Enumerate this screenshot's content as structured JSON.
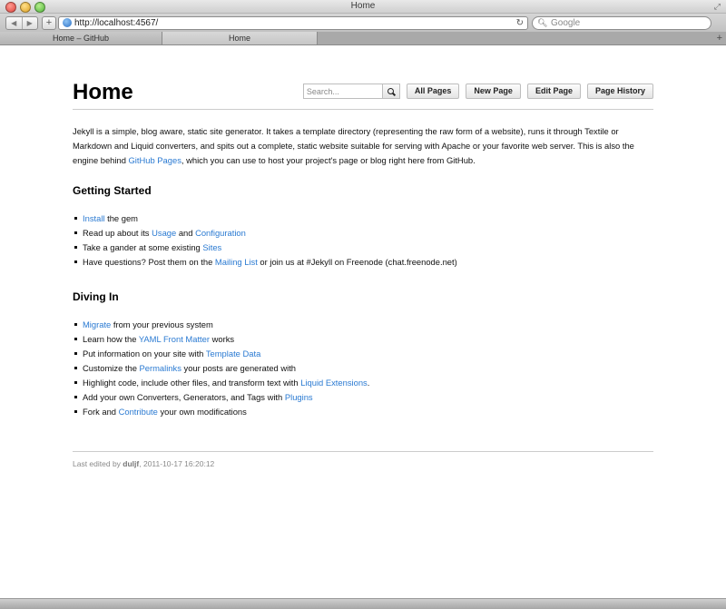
{
  "browser": {
    "window_title": "Home",
    "url": "http://localhost:4567/",
    "search_placeholder": "Google",
    "tabs": [
      "Home – GitHub",
      "Home"
    ],
    "back_glyph": "◀",
    "forward_glyph": "▶",
    "add_glyph": "+",
    "reload_glyph": "↻"
  },
  "page": {
    "title": "Home",
    "search_placeholder": "Search...",
    "buttons": {
      "all_pages": "All Pages",
      "new_page": "New Page",
      "edit_page": "Edit Page",
      "page_history": "Page History"
    },
    "intro": {
      "text_before": "Jekyll is a simple, blog aware, static site generator. It takes a template directory (representing the raw form of a website), runs it through Textile or Markdown and Liquid converters, and spits out a complete, static website suitable for serving with Apache or your favorite web server. This is also the engine behind ",
      "link": "GitHub Pages",
      "text_after": ", which you can use to host your project's page or blog right here from GitHub."
    },
    "getting_started": {
      "heading": "Getting Started",
      "items": [
        {
          "a": "",
          "link": "Install",
          "b": " the gem",
          "link2": "",
          "c": ""
        },
        {
          "a": "Read up about its ",
          "link": "Usage",
          "b": " and ",
          "link2": "Configuration",
          "c": ""
        },
        {
          "a": "Take a gander at some existing ",
          "link": "Sites",
          "b": "",
          "link2": "",
          "c": ""
        },
        {
          "a": "Have questions? Post them on the ",
          "link": "Mailing List",
          "b": " or join us at #Jekyll on Freenode (chat.freenode.net)",
          "link2": "",
          "c": ""
        }
      ]
    },
    "diving_in": {
      "heading": "Diving In",
      "items": [
        {
          "a": "",
          "link": "Migrate",
          "b": " from your previous system"
        },
        {
          "a": "Learn how the ",
          "link": "YAML Front Matter",
          "b": " works"
        },
        {
          "a": "Put information on your site with ",
          "link": "Template Data",
          "b": ""
        },
        {
          "a": "Customize the ",
          "link": "Permalinks",
          "b": " your posts are generated with"
        },
        {
          "a": "Highlight code, include other files, and transform text with ",
          "link": "Liquid Extensions",
          "b": "."
        },
        {
          "a": "Add your own Converters, Generators, and Tags with ",
          "link": "Plugins",
          "b": ""
        },
        {
          "a": "Fork and ",
          "link": "Contribute",
          "b": " your own modifications"
        }
      ]
    },
    "footer": {
      "prefix": "Last edited by ",
      "author": "duljf",
      "timestamp": ", 2011-10-17 16:20:12"
    }
  },
  "colors": {
    "link": "#2a7ad2",
    "footer_text": "#8a8a8a",
    "rule": "#cccccc"
  },
  "icons": [
    "globe-icon",
    "reload-icon",
    "search-icon",
    "plus-icon",
    "resize-icon"
  ]
}
